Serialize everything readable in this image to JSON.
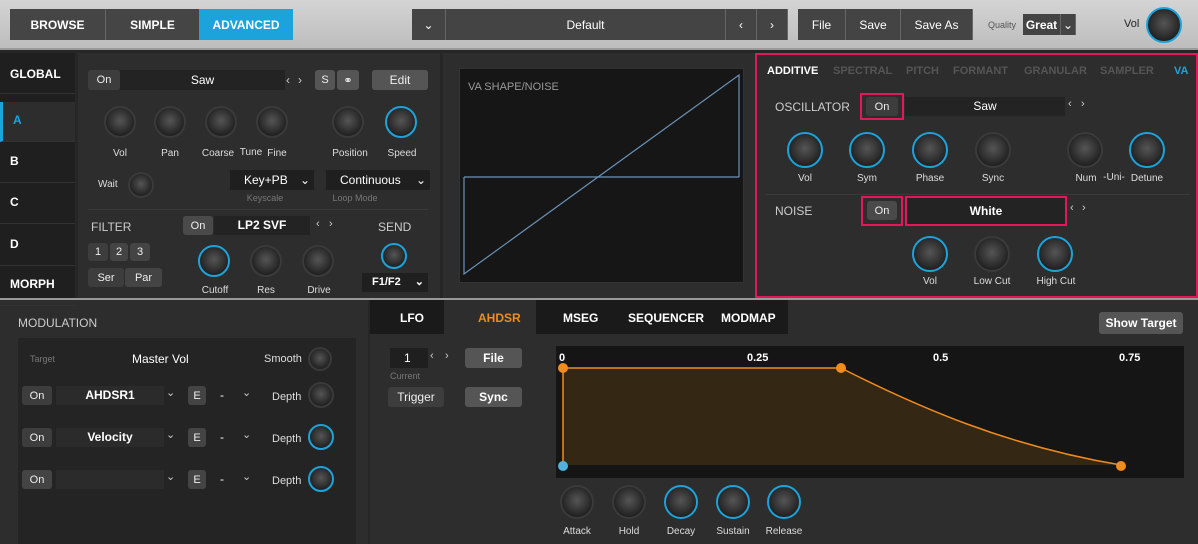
{
  "top": {
    "browse": "BROWSE",
    "simple": "SIMPLE",
    "advanced": "ADVANCED",
    "preset": "Default",
    "file": "File",
    "save": "Save",
    "save_as": "Save As",
    "quality_label": "Quality",
    "quality": "Great",
    "vol": "Vol"
  },
  "left_nav": [
    "GLOBAL",
    "A",
    "B",
    "C",
    "D",
    "MORPH"
  ],
  "osc": {
    "on": "On",
    "wave": "Saw",
    "s": "S",
    "edit": "Edit",
    "knobs": [
      "Vol",
      "Pan",
      "Coarse",
      "Tune",
      "Fine",
      "Position",
      "Speed"
    ],
    "wait": "Wait",
    "keyscale_val": "Key+PB",
    "keyscale": "Keyscale",
    "loop_val": "Continuous",
    "loop": "Loop Mode"
  },
  "filter": {
    "title": "FILTER",
    "n1": "1",
    "n2": "2",
    "n3": "3",
    "ser": "Ser",
    "par": "Par",
    "on": "On",
    "type": "LP2 SVF",
    "send": "SEND",
    "send_val": "F1/F2",
    "knobs": [
      "Cutoff",
      "Res",
      "Drive"
    ]
  },
  "shape": {
    "title": "VA SHAPE/NOISE"
  },
  "right_tabs": [
    "ADDITIVE",
    "SPECTRAL",
    "PITCH",
    "FORMANT",
    "GRANULAR",
    "SAMPLER",
    "VA"
  ],
  "va": {
    "osc_label": "OSCILLATOR",
    "osc_on": "On",
    "osc_wave": "Saw",
    "osc_knobs": [
      "Vol",
      "Sym",
      "Phase",
      "Sync",
      "Num",
      "-Uni-",
      "Detune"
    ],
    "noise_label": "NOISE",
    "noise_on": "On",
    "noise_type": "White",
    "noise_knobs": [
      "Vol",
      "Low Cut",
      "High Cut"
    ]
  },
  "mod": {
    "title": "MODULATION",
    "target": "Target",
    "master": "Master Vol",
    "smooth": "Smooth",
    "rows": [
      {
        "on": "On",
        "src": "AHDSR1",
        "e": "E",
        "dash": "-",
        "depth": "Depth"
      },
      {
        "on": "On",
        "src": "Velocity",
        "e": "E",
        "dash": "-",
        "depth": "Depth"
      },
      {
        "on": "On",
        "src": "",
        "e": "E",
        "dash": "-",
        "depth": "Depth"
      }
    ]
  },
  "env_tabs": [
    "LFO",
    "AHDSR",
    "MSEG",
    "SEQUENCER",
    "MODMAP"
  ],
  "env": {
    "show_target": "Show Target",
    "num": "1",
    "current": "Current",
    "file": "File",
    "trigger": "Trigger",
    "sync": "Sync",
    "ticks": [
      "0",
      "0.25",
      "0.5",
      "0.75"
    ],
    "knobs": [
      "Attack",
      "Hold",
      "Decay",
      "Sustain",
      "Release"
    ]
  },
  "colors": {
    "accent": "#1ca3dc",
    "highlight": "#e2185b",
    "env": "#f08c1e"
  }
}
